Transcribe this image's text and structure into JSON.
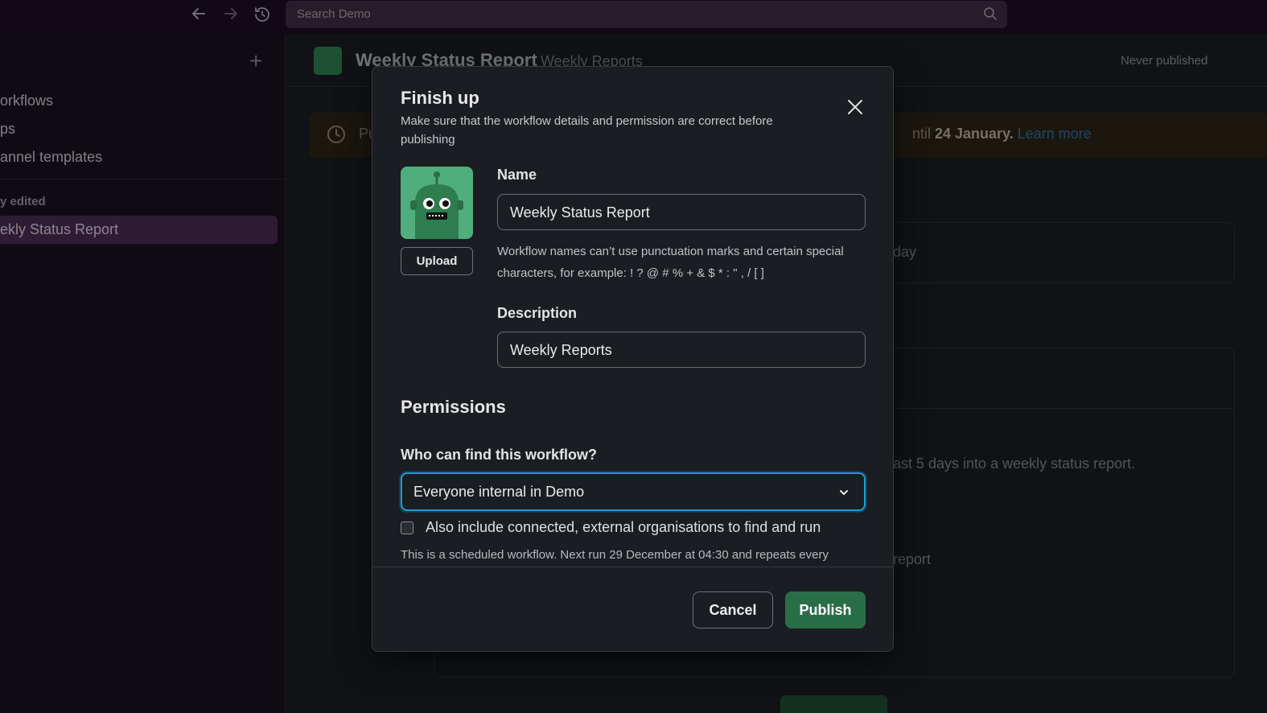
{
  "topbar": {
    "search_placeholder": "Search Demo",
    "icons": [
      "arrow-left-icon",
      "arrow-right-icon",
      "history-icon",
      "search-icon"
    ]
  },
  "sidebar": {
    "items": [
      "orkflows",
      "ps",
      "annel templates"
    ],
    "section_label": "y edited",
    "active_item": "ekly Status Report"
  },
  "main": {
    "workflow_title": "Weekly Status Report",
    "workflow_description": "Weekly Reports",
    "publish_status": "Never published",
    "banner": {
      "partial_text": "Pu",
      "until_text": "ntil ",
      "until_date": "24 January.",
      "learn_more": "Learn more"
    },
    "card1_text": "day",
    "card2_text1": "ast 5 days into a weekly status report.",
    "card2_text2": "report"
  },
  "modal": {
    "title": "Finish up",
    "subtitle": "Make sure that the workflow details and permission are correct before publishing",
    "upload_label": "Upload",
    "name_label": "Name",
    "name_value": "Weekly Status Report",
    "name_hint": "Workflow names can’t use punctuation marks and certain special characters, for example: ! ? @ # % + & $ * : \" , / [ ]",
    "description_label": "Description",
    "description_value": "Weekly Reports",
    "permissions_title": "Permissions",
    "who_can_find_label": "Who can find this workflow?",
    "who_can_find_value": "Everyone internal in Demo",
    "external_checkbox_label": "Also include connected, external organisations to find and run",
    "external_checked": false,
    "schedule_note": "This is a scheduled workflow. Next run 29 December at 04:30 and repeats every",
    "cancel_label": "Cancel",
    "publish_label": "Publish"
  },
  "colors": {
    "accent_blue": "#1d9bd1",
    "publish_green": "#2a6e48",
    "bot_green": "#4fae7c",
    "sidebar_active": "#4a2a52"
  }
}
